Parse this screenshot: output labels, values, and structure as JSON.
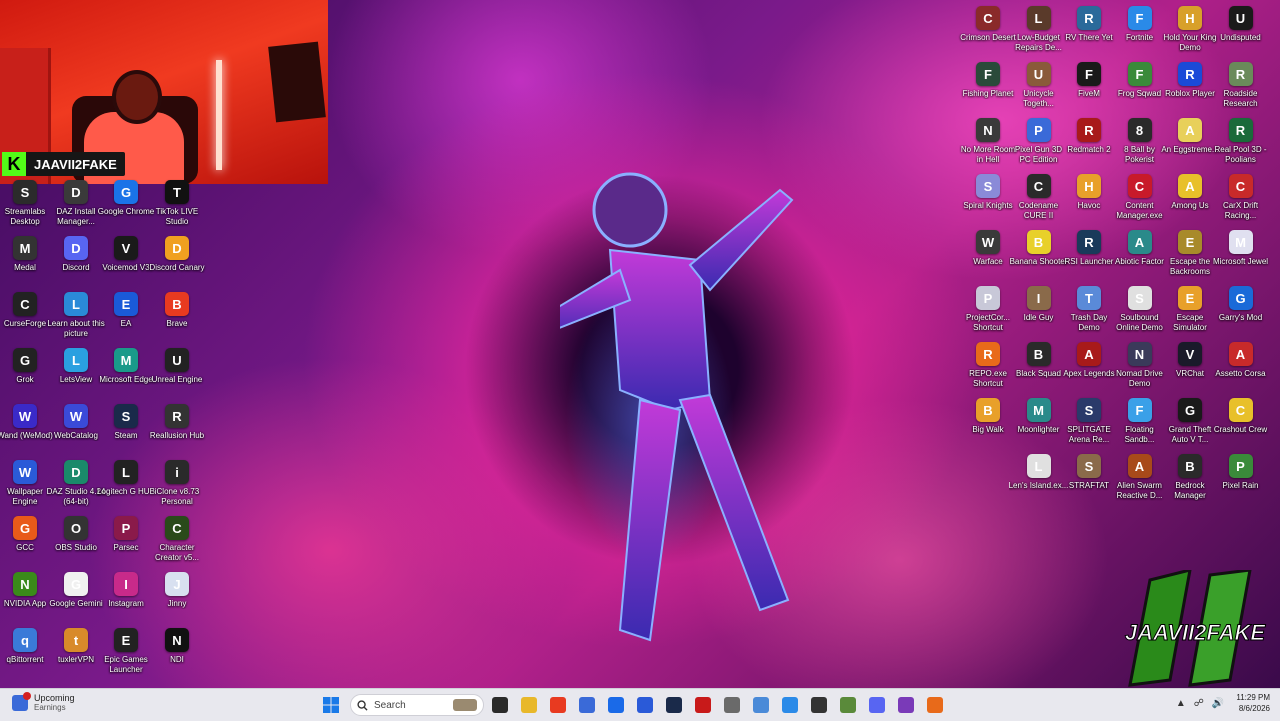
{
  "webcam": {
    "streamer_name": "JAAVII2FAKE",
    "platform_badge": "K"
  },
  "watermark": {
    "text": "JAAVII2FAKE"
  },
  "desktop_left": [
    {
      "label": "Streamlabs Desktop",
      "icon": "streamlabs-icon",
      "color": "#2b2b2b"
    },
    {
      "label": "DAZ Install Manager...",
      "icon": "daz-install-manager-icon",
      "color": "#3a3a3a"
    },
    {
      "label": "Google Chrome",
      "icon": "chrome-icon",
      "color": "#1a73e8"
    },
    {
      "label": "TikTok LIVE Studio",
      "icon": "tiktok-icon",
      "color": "#111111"
    },
    {
      "label": "Medal",
      "icon": "medal-icon",
      "color": "#333333"
    },
    {
      "label": "Discord",
      "icon": "discord-icon",
      "color": "#5865f2"
    },
    {
      "label": "Voicemod V3",
      "icon": "voicemod-icon",
      "color": "#1a1a1a"
    },
    {
      "label": "Discord Canary",
      "icon": "discord-canary-icon",
      "color": "#f0a020"
    },
    {
      "label": "CurseForge",
      "icon": "curseforge-icon",
      "color": "#222222"
    },
    {
      "label": "Learn about this picture",
      "icon": "spotlight-icon",
      "color": "#2a8ad8"
    },
    {
      "label": "EA",
      "icon": "ea-icon",
      "color": "#1a5ad8"
    },
    {
      "label": "Brave",
      "icon": "brave-icon",
      "color": "#e83a20"
    },
    {
      "label": "Grok",
      "icon": "grok-icon",
      "color": "#222222"
    },
    {
      "label": "LetsView",
      "icon": "letsview-icon",
      "color": "#2aa0e0"
    },
    {
      "label": "Microsoft Edge",
      "icon": "edge-icon",
      "color": "#1a9a8a"
    },
    {
      "label": "Unreal Engine",
      "icon": "unreal-icon",
      "color": "#222222"
    },
    {
      "label": "Wand (WeMod)",
      "icon": "wand-icon",
      "color": "#3a2ac8"
    },
    {
      "label": "WebCatalog",
      "icon": "webcatalog-icon",
      "color": "#3a4ad8"
    },
    {
      "label": "Steam",
      "icon": "steam-icon",
      "color": "#1a2a4a"
    },
    {
      "label": "Reallusion Hub",
      "icon": "reallusion-icon",
      "color": "#333333"
    },
    {
      "label": "Wallpaper Engine",
      "icon": "wallpaper-engine-icon",
      "color": "#2a5ad8"
    },
    {
      "label": "DAZ Studio 4.24 (64-bit)",
      "icon": "daz-studio-icon",
      "color": "#1a8a6a"
    },
    {
      "label": "Logitech G HUB",
      "icon": "logitech-icon",
      "color": "#222222"
    },
    {
      "label": "iClone v8.73 Personal",
      "icon": "iclone-icon",
      "color": "#2a2a2a"
    },
    {
      "label": "GCC",
      "icon": "gcc-icon",
      "color": "#e85a1a"
    },
    {
      "label": "OBS Studio",
      "icon": "obs-icon",
      "color": "#333333"
    },
    {
      "label": "Parsec",
      "icon": "parsec-icon",
      "color": "#8a1a4a"
    },
    {
      "label": "Character Creator v5...",
      "icon": "character-creator-icon",
      "color": "#2a4a1a"
    },
    {
      "label": "NVIDIA App",
      "icon": "nvidia-icon",
      "color": "#3a8a1a"
    },
    {
      "label": "Google Gemini",
      "icon": "gemini-icon",
      "color": "#f0f0f0"
    },
    {
      "label": "Instagram",
      "icon": "instagram-icon",
      "color": "#c82a8a"
    },
    {
      "label": "Jinny",
      "icon": "jinny-icon",
      "color": "#d8e0f0"
    },
    {
      "label": "qBittorrent",
      "icon": "qbittorrent-icon",
      "color": "#3a7ad8"
    },
    {
      "label": "tuxlerVPN",
      "icon": "tuxler-icon",
      "color": "#d88a2a"
    },
    {
      "label": "Epic Games Launcher",
      "icon": "epic-icon",
      "color": "#222222"
    },
    {
      "label": "NDI",
      "icon": "ndi-icon",
      "color": "#111111"
    }
  ],
  "desktop_right": [
    {
      "label": "Crimson Desert",
      "icon": "crimson-desert-icon",
      "color": "#8a2a2a"
    },
    {
      "label": "Low-Budget Repairs De...",
      "icon": "low-budget-icon",
      "color": "#5a3a2a"
    },
    {
      "label": "RV There Yet",
      "icon": "rv-icon",
      "color": "#2a6a9a"
    },
    {
      "label": "Fortnite",
      "icon": "fortnite-icon",
      "color": "#2a8ae8"
    },
    {
      "label": "Hold Your King Demo",
      "icon": "hold-king-icon",
      "color": "#d8a02a"
    },
    {
      "label": "Undisputed",
      "icon": "undisputed-icon",
      "color": "#1a1a1a"
    },
    {
      "label": "Fishing Planet",
      "icon": "fishing-icon",
      "color": "#2a4a3a"
    },
    {
      "label": "Unicycle Togeth...",
      "icon": "unicycle-icon",
      "color": "#8a5a3a"
    },
    {
      "label": "FiveM",
      "icon": "fivem-icon",
      "color": "#1a1a1a"
    },
    {
      "label": "Frog Sqwad",
      "icon": "frog-icon",
      "color": "#3a8a3a"
    },
    {
      "label": "Roblox Player",
      "icon": "roblox-icon",
      "color": "#1a4ad8"
    },
    {
      "label": "Roadside Research",
      "icon": "roadside-icon",
      "color": "#6a8a5a"
    },
    {
      "label": "No More Room in Hell",
      "icon": "nmrih-icon",
      "color": "#3a3a3a"
    },
    {
      "label": "Pixel Gun 3D PC Edition",
      "icon": "pixel-gun-icon",
      "color": "#3a6ad8"
    },
    {
      "label": "Redmatch 2",
      "icon": "redmatch-icon",
      "color": "#a81a1a"
    },
    {
      "label": "8 Ball by Pokerist",
      "icon": "8ball-icon",
      "color": "#2a2a2a"
    },
    {
      "label": "An Eggstreme...",
      "icon": "eggstreme-icon",
      "color": "#e8d05a"
    },
    {
      "label": "Real Pool 3D - Poolians",
      "icon": "pool-icon",
      "color": "#1a6a3a"
    },
    {
      "label": "Spiral Knights",
      "icon": "spiral-knights-icon",
      "color": "#8a8ad8"
    },
    {
      "label": "Codename CURE II",
      "icon": "cure-icon",
      "color": "#2a2a2a"
    },
    {
      "label": "Havoc",
      "icon": "havoc-icon",
      "color": "#e8a02a"
    },
    {
      "label": "Content Manager.exe",
      "icon": "content-manager-icon",
      "color": "#c81a2a"
    },
    {
      "label": "Among Us",
      "icon": "among-us-icon",
      "color": "#e8c02a"
    },
    {
      "label": "CarX Drift Racing...",
      "icon": "carx-icon",
      "color": "#c82a2a"
    },
    {
      "label": "Warface",
      "icon": "warface-icon",
      "color": "#3a3a3a"
    },
    {
      "label": "Banana Shooter",
      "icon": "banana-icon",
      "color": "#e8d02a"
    },
    {
      "label": "RSI Launcher",
      "icon": "rsi-icon",
      "color": "#1a3a5a"
    },
    {
      "label": "Abiotic Factor",
      "icon": "abiotic-icon",
      "color": "#2a8a8a"
    },
    {
      "label": "Escape the Backrooms",
      "icon": "backrooms-icon",
      "color": "#a88a2a"
    },
    {
      "label": "Microsoft Jewel",
      "icon": "jewel-icon",
      "color": "#e0e0f0"
    },
    {
      "label": "ProjectCor... Shortcut",
      "icon": "projectcor-icon",
      "color": "#c8c8d8"
    },
    {
      "label": "Idle Guy",
      "icon": "idle-guy-icon",
      "color": "#8a6a4a"
    },
    {
      "label": "Trash Day Demo",
      "icon": "trash-day-icon",
      "color": "#5a8ad8"
    },
    {
      "label": "Soulbound Online Demo",
      "icon": "soulbound-icon",
      "color": "#e0e0e0"
    },
    {
      "label": "Escape Simulator",
      "icon": "escape-sim-icon",
      "color": "#e8a02a"
    },
    {
      "label": "Garry's Mod",
      "icon": "gmod-icon",
      "color": "#1a6ad8"
    },
    {
      "label": "REPO.exe Shortcut",
      "icon": "repo-icon",
      "color": "#e86a1a"
    },
    {
      "label": "Black Squad",
      "icon": "black-squad-icon",
      "color": "#2a2a2a"
    },
    {
      "label": "Apex Legends",
      "icon": "apex-icon",
      "color": "#a81a1a"
    },
    {
      "label": "Nomad Drive Demo",
      "icon": "nomad-icon",
      "color": "#3a3a5a"
    },
    {
      "label": "VRChat",
      "icon": "vrchat-icon",
      "color": "#1a1a2a"
    },
    {
      "label": "Assetto Corsa",
      "icon": "assetto-icon",
      "color": "#c82a2a"
    },
    {
      "label": "Big Walk",
      "icon": "big-walk-icon",
      "color": "#e8a02a"
    },
    {
      "label": "Moonlighter",
      "icon": "moonlighter-icon",
      "color": "#2a8a8a"
    },
    {
      "label": "SPLITGATE Arena Re...",
      "icon": "splitgate-icon",
      "color": "#2a3a6a"
    },
    {
      "label": "Floating Sandb...",
      "icon": "floating-icon",
      "color": "#3aa0e8"
    },
    {
      "label": "Grand Theft Auto V T...",
      "icon": "gta-icon",
      "color": "#1a1a1a"
    },
    {
      "label": "Crashout Crew",
      "icon": "crashout-icon",
      "color": "#e8c02a"
    },
    {
      "label": "",
      "icon": "",
      "color": ""
    },
    {
      "label": "Len's Island.ex...",
      "icon": "lens-island-icon",
      "color": "#e0e0e0"
    },
    {
      "label": "STRAFTAT",
      "icon": "straftat-icon",
      "color": "#8a6a4a"
    },
    {
      "label": "Alien Swarm Reactive D...",
      "icon": "alien-swarm-icon",
      "color": "#a84a1a"
    },
    {
      "label": "Bedrock Manager",
      "icon": "bedrock-icon",
      "color": "#2a2a2a"
    },
    {
      "label": "Pixel Rain",
      "icon": "pixel-rain-icon",
      "color": "#3a8a3a"
    }
  ],
  "taskbar": {
    "weather_title": "Upcoming",
    "weather_sub": "Earnings",
    "search_placeholder": "Search",
    "apps": [
      {
        "name": "task-view",
        "color": "#2a2a2a"
      },
      {
        "name": "file-explorer",
        "color": "#e8b82a"
      },
      {
        "name": "brave",
        "color": "#e83a20"
      },
      {
        "name": "app-blue",
        "color": "#3a6ad8"
      },
      {
        "name": "facebook",
        "color": "#1a6ae8"
      },
      {
        "name": "store",
        "color": "#2a5ad8"
      },
      {
        "name": "steam",
        "color": "#1a2a4a"
      },
      {
        "name": "recorder",
        "color": "#c81a1a"
      },
      {
        "name": "settings",
        "color": "#6a6a6a"
      },
      {
        "name": "paint",
        "color": "#4a8ad8"
      },
      {
        "name": "docs",
        "color": "#2a8ae8"
      },
      {
        "name": "obs",
        "color": "#333333"
      },
      {
        "name": "minecraft",
        "color": "#5a8a3a"
      },
      {
        "name": "discord",
        "color": "#5865f2"
      },
      {
        "name": "tor",
        "color": "#7a3ab8"
      },
      {
        "name": "brave-2",
        "color": "#e86a1a"
      }
    ],
    "time": "11:29 PM",
    "date": "8/6/2026"
  }
}
